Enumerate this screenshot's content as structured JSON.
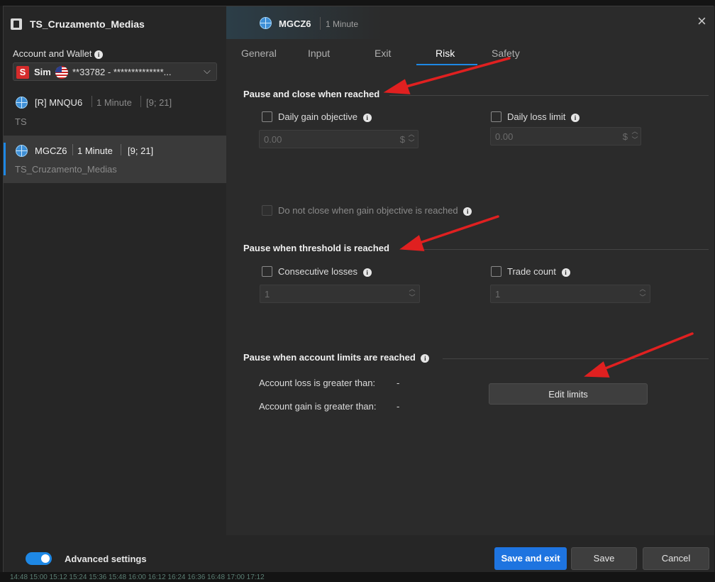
{
  "app": {
    "title": "TS_Cruzamento_Medias",
    "header_symbol": "MGCZ6",
    "header_interval": "1 Minute"
  },
  "account": {
    "label": "Account and Wallet",
    "badge": "S",
    "mode": "Sim",
    "account_text": "**33782 - **************..."
  },
  "strategies": [
    {
      "symbol": "[R] MNQU6",
      "interval": "1 Minute",
      "params": "[9; 21]",
      "name": "TS",
      "selected": false
    },
    {
      "symbol": "MGCZ6",
      "interval": "1 Minute",
      "params": "[9; 21]",
      "name": "TS_Cruzamento_Medias",
      "selected": true
    }
  ],
  "tabs": [
    "General",
    "Input",
    "Exit",
    "Risk",
    "Safety"
  ],
  "active_tab": "Risk",
  "risk": {
    "section1_title": "Pause and close when reached",
    "daily_gain_label": "Daily gain objective",
    "daily_gain_value": "0.00",
    "daily_loss_label": "Daily loss limit",
    "daily_loss_value": "0.00",
    "currency_symbol": "$",
    "do_not_close_label": "Do not close when gain objective is reached",
    "section2_title": "Pause when threshold is reached",
    "consecutive_losses_label": "Consecutive losses",
    "consecutive_losses_value": "1",
    "trade_count_label": "Trade count",
    "trade_count_value": "1",
    "section3_title": "Pause when account limits are reached",
    "account_loss_label": "Account loss is greater than:",
    "account_loss_value": "-",
    "account_gain_label": "Account gain is greater than:",
    "account_gain_value": "-",
    "edit_limits_label": "Edit limits"
  },
  "footer": {
    "advanced_label": "Advanced settings",
    "advanced_on": true,
    "save_exit_label": "Save and exit",
    "save_label": "Save",
    "cancel_label": "Cancel"
  },
  "background_axis": "14:48   15:00   15:12   15:24   15:36   15:48   16:00   16:12   16:24   16:36   16:48   17:00   17:12",
  "colors": {
    "accent": "#1e88e5",
    "primary_button": "#1e74e0",
    "arrow": "#e02020",
    "badge_bg": "#d52b2b"
  }
}
